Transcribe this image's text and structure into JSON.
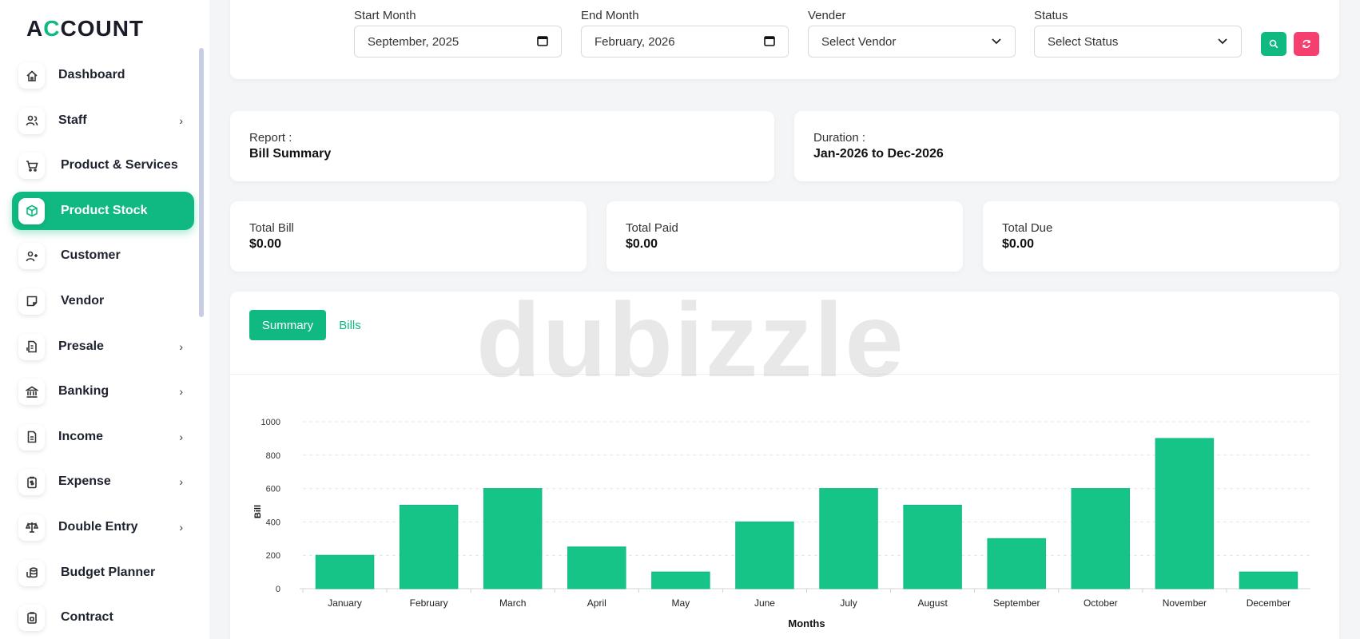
{
  "sidebar": {
    "logo": {
      "first": "A",
      "accent": "C",
      "rest": "COUNT"
    },
    "items": [
      {
        "label": "Dashboard",
        "icon": "home-icon",
        "chevron": false
      },
      {
        "label": "Staff",
        "icon": "users-icon",
        "chevron": true
      },
      {
        "label": "Product & Services",
        "icon": "cart-icon",
        "chevron": false
      },
      {
        "label": "Product Stock",
        "icon": "box-icon",
        "chevron": false,
        "active": true
      },
      {
        "label": "Customer",
        "icon": "user-plus-icon",
        "chevron": false
      },
      {
        "label": "Vendor",
        "icon": "note-icon",
        "chevron": false
      },
      {
        "label": "Presale",
        "icon": "file-dollar-icon",
        "chevron": true
      },
      {
        "label": "Banking",
        "icon": "bank-icon",
        "chevron": true
      },
      {
        "label": "Income",
        "icon": "file-icon",
        "chevron": true
      },
      {
        "label": "Expense",
        "icon": "clipboard-dollar-icon",
        "chevron": true
      },
      {
        "label": "Double Entry",
        "icon": "scale-icon",
        "chevron": true
      },
      {
        "label": "Budget Planner",
        "icon": "coins-icon",
        "chevron": false
      },
      {
        "label": "Contract",
        "icon": "contract-icon",
        "chevron": false
      }
    ],
    "chevron_glyph": "›"
  },
  "filters": {
    "start_month": {
      "label": "Start Month",
      "value": "September, 2025"
    },
    "end_month": {
      "label": "End Month",
      "value": "February, 2026"
    },
    "vendor": {
      "label": "Vender",
      "value": "Select Vendor"
    },
    "status": {
      "label": "Status",
      "value": "Select Status"
    },
    "search_icon": "search-icon",
    "reset_icon": "refresh-icon"
  },
  "report": {
    "title": "Report :",
    "value": "Bill Summary"
  },
  "duration": {
    "title": "Duration :",
    "value": "Jan-2026 to Dec-2026"
  },
  "totals": {
    "bill": {
      "title": "Total Bill",
      "value": "$0.00"
    },
    "paid": {
      "title": "Total Paid",
      "value": "$0.00"
    },
    "due": {
      "title": "Total Due",
      "value": "$0.00"
    }
  },
  "tabs": {
    "summary": "Summary",
    "bills": "Bills"
  },
  "watermark": "dubizzle",
  "colors": {
    "accent": "#10b981",
    "danger": "#f43f6f"
  },
  "chart_data": {
    "type": "bar",
    "categories": [
      "January",
      "February",
      "March",
      "April",
      "May",
      "June",
      "July",
      "August",
      "September",
      "October",
      "November",
      "December"
    ],
    "values": [
      200,
      500,
      600,
      250,
      100,
      400,
      600,
      500,
      300,
      600,
      900,
      100
    ],
    "xlabel": "Months",
    "ylabel": "Bill",
    "ylim": [
      0,
      1000
    ],
    "yticks": [
      0,
      200,
      400,
      600,
      800,
      1000
    ],
    "grid": true
  }
}
